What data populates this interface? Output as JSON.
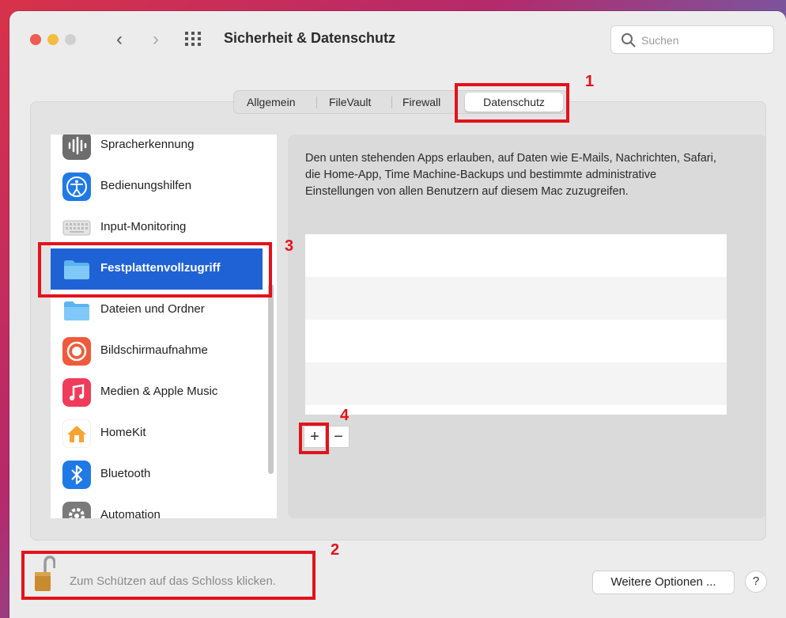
{
  "window": {
    "title": "Sicherheit & Datenschutz"
  },
  "search": {
    "placeholder": "Suchen"
  },
  "tabs": [
    {
      "label": "Allgemein"
    },
    {
      "label": "FileVault"
    },
    {
      "label": "Firewall"
    },
    {
      "label": "Datenschutz",
      "selected": true
    }
  ],
  "sidebar": {
    "items": [
      {
        "label": "Spracherkennung",
        "icon": "waveform-icon",
        "color": "#6d6d6d"
      },
      {
        "label": "Bedienungshilfen",
        "icon": "accessibility-icon",
        "color": "#1f7ae6"
      },
      {
        "label": "Input-Monitoring",
        "icon": "keyboard-icon",
        "color": "#d8d8d8"
      },
      {
        "label": "Festplattenvollzugriff",
        "icon": "folder-icon",
        "color": "#5ab4f0",
        "selected": true
      },
      {
        "label": "Dateien und Ordner",
        "icon": "folder-icon",
        "color": "#5ab4f0"
      },
      {
        "label": "Bildschirmaufnahme",
        "icon": "screen-record-icon",
        "color": "#f05a3c"
      },
      {
        "label": "Medien & Apple Music",
        "icon": "music-note-icon",
        "color": "#f03c5a"
      },
      {
        "label": "HomeKit",
        "icon": "home-icon",
        "color": "#f7a531"
      },
      {
        "label": "Bluetooth",
        "icon": "bluetooth-icon",
        "color": "#1f7ae6"
      },
      {
        "label": "Automation",
        "icon": "gear-icon",
        "color": "#7a7a7a"
      }
    ]
  },
  "main": {
    "description": "Den unten stehenden Apps erlauben, auf Daten wie E-Mails, Nachrichten, Safari, die Home-App, Time Machine-Backups und bestimmte administrative Einstellungen von allen Benutzern auf diesem Mac zuzugreifen.",
    "add_label": "+",
    "remove_label": "−"
  },
  "footer": {
    "lock_text": "Zum Schützen auf das Schloss klicken.",
    "more_options": "Weitere Optionen ...",
    "help": "?"
  },
  "annotations": [
    {
      "number": "1"
    },
    {
      "number": "2"
    },
    {
      "number": "3"
    },
    {
      "number": "4"
    }
  ],
  "colors": {
    "accent": "#1f62d6",
    "annotation": "#e3121b"
  }
}
